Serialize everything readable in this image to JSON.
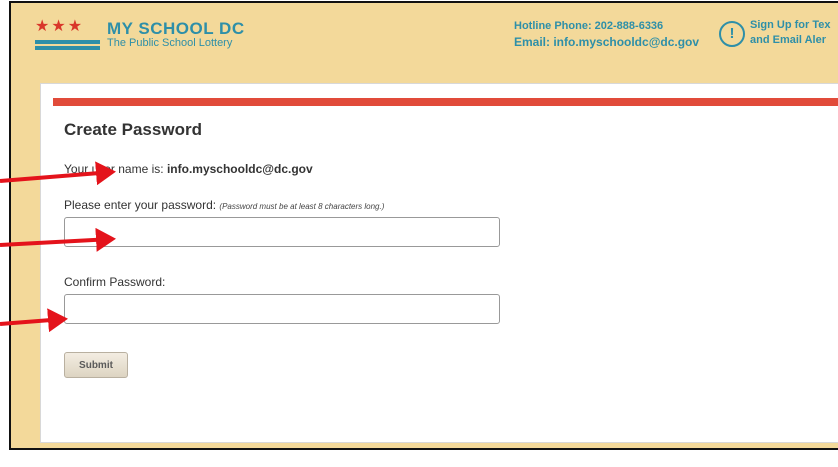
{
  "header": {
    "brand_title": "MY SCHOOL DC",
    "brand_subtitle": "The Public School Lottery",
    "hotline": "Hotline Phone: 202-888-6336",
    "email": "Email: info.myschooldc@dc.gov",
    "signup_line1": "Sign Up for Tex",
    "signup_line2": "and Email Aler",
    "alert_icon": "exclamation-circle-icon"
  },
  "form": {
    "title": "Create Password",
    "username_prefix": "Your user name is: ",
    "username_value": "info.myschooldc@dc.gov",
    "password_label": "Please enter your password: ",
    "password_note": "(Password must be at least 8 characters long.)",
    "password_value": "",
    "confirm_label": "Confirm Password:",
    "confirm_value": "",
    "submit_label": "Submit"
  },
  "colors": {
    "header_bg": "#f3d99a",
    "brand": "#2e8fa8",
    "accent_red": "#e14b3a",
    "annotation_arrow": "#e4131b"
  },
  "annotations": {
    "arrow_icon": "red-arrow-icon",
    "count": 3
  }
}
